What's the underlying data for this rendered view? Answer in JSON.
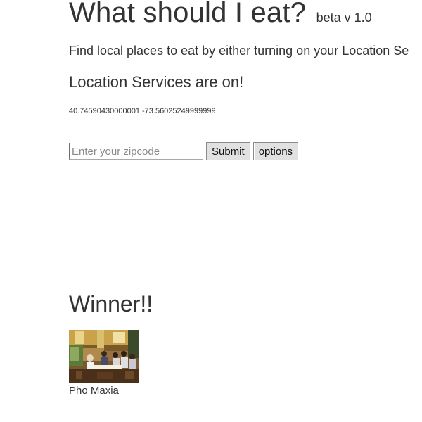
{
  "header": {
    "title": "What should I eat?",
    "version": "beta v 1.0"
  },
  "intro_text": "Find local places to eat by either turning on your Location Se",
  "status_text": "Location Services are on!",
  "coordinates_text": "40.74590430000001 -73.56025249999999",
  "form": {
    "zip_placeholder": "Enter your zipcode",
    "zip_value": "",
    "submit_label": "Submit",
    "options_label": "options"
  },
  "winner": {
    "heading": "Winner!!",
    "name": "Pho Maxia"
  }
}
